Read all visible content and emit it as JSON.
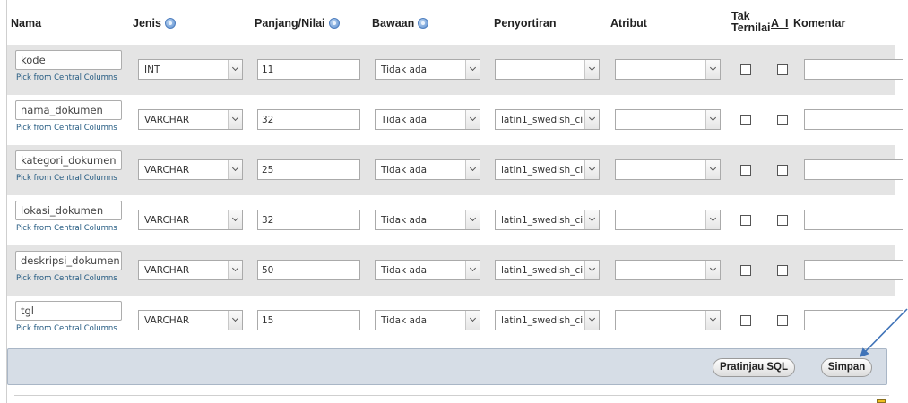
{
  "headers": {
    "nama": "Nama",
    "jenis": "Jenis",
    "panjang": "Panjang/Nilai",
    "bawaan": "Bawaan",
    "penyortiran": "Penyortiran",
    "atribut": "Atribut",
    "tak_line1": "Tak",
    "tak_line2": "Ternilai",
    "ai": "A_I",
    "komentar": "Komentar"
  },
  "pick_label": "Pick from Central Columns",
  "rows": [
    {
      "name": "kode",
      "type": "INT",
      "length": "11",
      "default": "Tidak ada",
      "collation": "",
      "attribute": ""
    },
    {
      "name": "nama_dokumen",
      "type": "VARCHAR",
      "length": "32",
      "default": "Tidak ada",
      "collation": "latin1_swedish_ci",
      "attribute": ""
    },
    {
      "name": "kategori_dokumen",
      "type": "VARCHAR",
      "length": "25",
      "default": "Tidak ada",
      "collation": "latin1_swedish_ci",
      "attribute": ""
    },
    {
      "name": "lokasi_dokumen",
      "type": "VARCHAR",
      "length": "32",
      "default": "Tidak ada",
      "collation": "latin1_swedish_ci",
      "attribute": ""
    },
    {
      "name": "deskripsi_dokumen",
      "type": "VARCHAR",
      "length": "50",
      "default": "Tidak ada",
      "collation": "latin1_swedish_ci",
      "attribute": ""
    },
    {
      "name": "tgl",
      "type": "VARCHAR",
      "length": "15",
      "default": "Tidak ada",
      "collation": "latin1_swedish_ci",
      "attribute": ""
    }
  ],
  "buttons": {
    "preview_sql": "Pratinjau SQL",
    "save": "Simpan"
  },
  "colors": {
    "row_alt": "#e4e4e4",
    "footer_bg": "#d6dde6",
    "link": "#235a81",
    "annotation_arrow": "#3f73b8"
  },
  "icons": {
    "help": "help-icon",
    "dropdown": "chevron-down-icon",
    "annotation": "arrow-annotation"
  }
}
